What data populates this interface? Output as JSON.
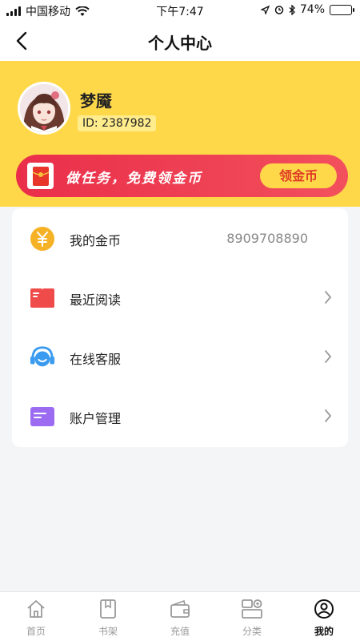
{
  "status_bar": {
    "carrier": "中国移动",
    "time": "下午7:47",
    "battery_percent": "74%",
    "battery_level": 0.74
  },
  "nav": {
    "title": "个人中心",
    "back_icon": "chevron-left-icon"
  },
  "profile": {
    "username": "梦魇",
    "user_id": "ID: 2387982"
  },
  "task_banner": {
    "text": "做任务，免费领金币",
    "button_label": "领金币",
    "icon": "red-envelope-icon"
  },
  "menu": {
    "items": [
      {
        "label": "我的金币",
        "value": "8909708890",
        "icon": "coin-icon",
        "color": "#f6b226"
      },
      {
        "label": "最近阅读",
        "icon": "book-icon",
        "color": "#ef4b4b"
      },
      {
        "label": "在线客服",
        "icon": "headset-icon",
        "color": "#3a9bf0"
      },
      {
        "label": "账户管理",
        "icon": "card-icon",
        "color": "#9b6cf2"
      }
    ]
  },
  "tabs": [
    {
      "label": "首页",
      "icon": "home-icon",
      "active": false
    },
    {
      "label": "书架",
      "icon": "bookshelf-icon",
      "active": false
    },
    {
      "label": "充值",
      "icon": "wallet-icon",
      "active": false
    },
    {
      "label": "分类",
      "icon": "category-icon",
      "active": false
    },
    {
      "label": "我的",
      "icon": "user-icon",
      "active": true
    }
  ],
  "colors": {
    "header_yellow": "#ffd84a",
    "banner_red": "#ea2e4a",
    "claim_button": "#ffd84a"
  }
}
